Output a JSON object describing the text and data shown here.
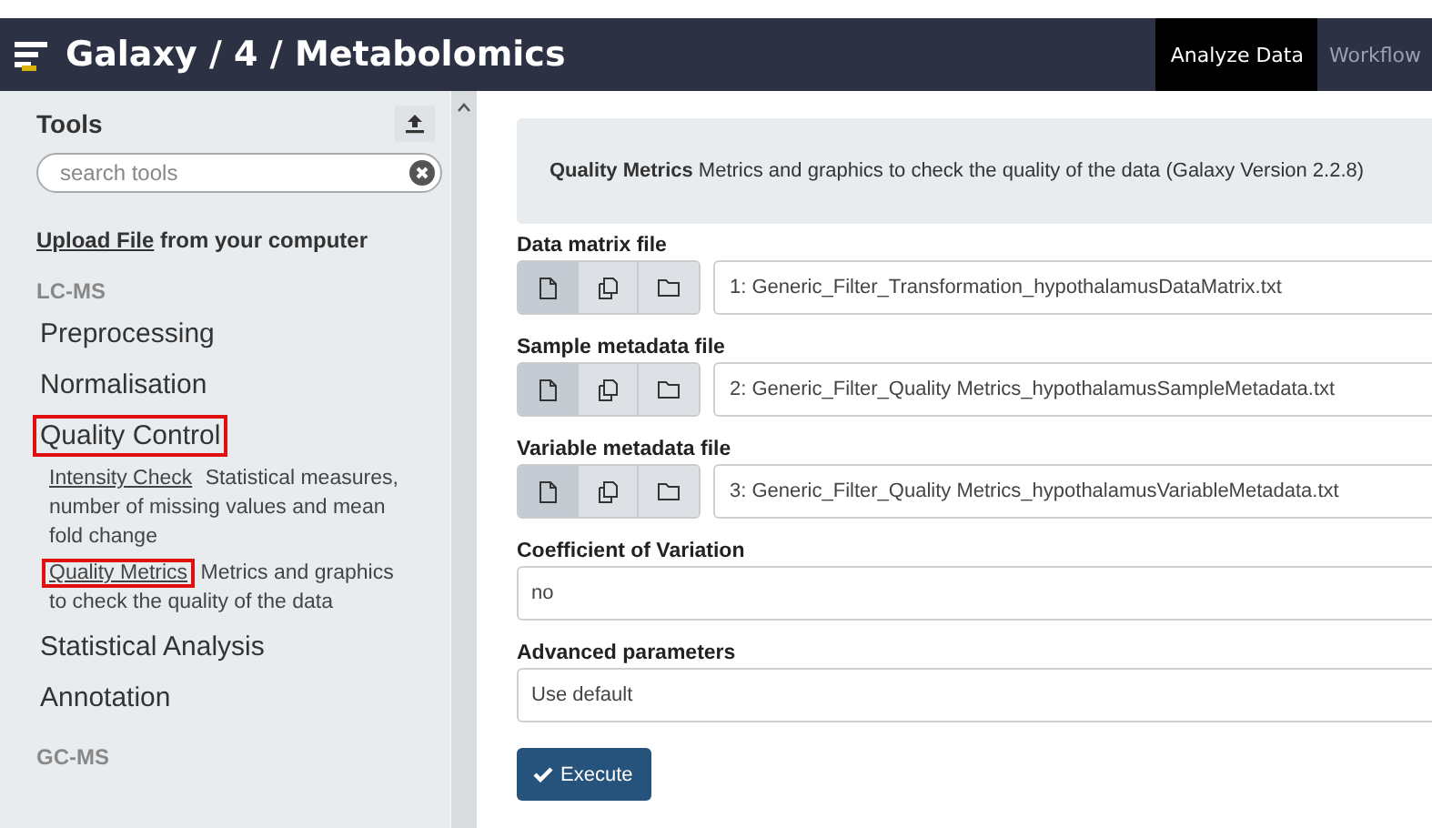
{
  "masthead": {
    "brand": "Galaxy / 4 / Metabolomics",
    "tabs": [
      {
        "label": "Analyze Data",
        "selected": true
      },
      {
        "label": "Workflow",
        "selected": false
      }
    ]
  },
  "tool_panel": {
    "title": "Tools",
    "search": {
      "placeholder": "search tools"
    },
    "upload": {
      "link": "Upload File",
      "text": "from your computer"
    },
    "items": [
      {
        "kind": "section",
        "label": "LC-MS"
      },
      {
        "kind": "category",
        "label": "Preprocessing",
        "highlighted": false
      },
      {
        "kind": "category",
        "label": "Normalisation",
        "highlighted": false
      },
      {
        "kind": "category",
        "label": "Quality Control",
        "highlighted": true,
        "children": [
          {
            "name": "Intensity Check",
            "description": "Statistical measures, number of missing values and mean fold change",
            "highlighted": false
          },
          {
            "name": "Quality Metrics",
            "description": "Metrics and graphics to check the quality of the data",
            "highlighted": true
          }
        ]
      },
      {
        "kind": "category",
        "label": "Statistical Analysis",
        "highlighted": false
      },
      {
        "kind": "category",
        "label": "Annotation",
        "highlighted": false
      },
      {
        "kind": "section",
        "label": "GC-MS"
      }
    ]
  },
  "tool_form": {
    "name": "Quality Metrics",
    "description": "Metrics and graphics to check the quality of the data (Galaxy Version 2.2.8)",
    "params": [
      {
        "kind": "data",
        "label": "Data matrix file",
        "modes": [
          {
            "selected": true
          },
          {
            "selected": false
          },
          {
            "selected": false
          }
        ],
        "value": "1: Generic_Filter_Transformation_hypothalamusDataMatrix.txt"
      },
      {
        "kind": "data",
        "label": "Sample metadata file",
        "modes": [
          {
            "selected": true
          },
          {
            "selected": false
          },
          {
            "selected": false
          }
        ],
        "value": "2: Generic_Filter_Quality Metrics_hypothalamusSampleMetadata.txt"
      },
      {
        "kind": "data",
        "label": "Variable metadata file",
        "modes": [
          {
            "selected": true
          },
          {
            "selected": false
          },
          {
            "selected": false
          }
        ],
        "value": "3: Generic_Filter_Quality Metrics_hypothalamusVariableMetadata.txt"
      },
      {
        "kind": "select",
        "label": "Coefficient of Variation",
        "value": "no"
      },
      {
        "kind": "select",
        "label": "Advanced parameters",
        "value": "Use default"
      }
    ],
    "execute": "Execute"
  }
}
